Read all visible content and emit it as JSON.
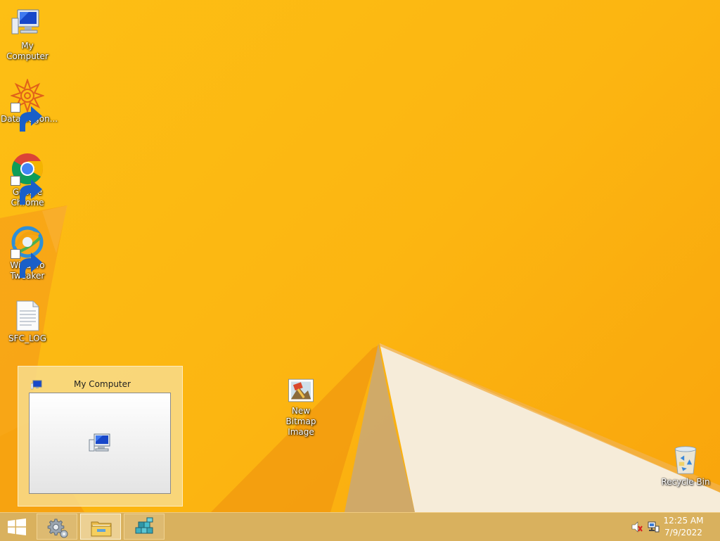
{
  "desktop": {
    "icons": [
      {
        "label": "My Computer",
        "icon": "computer-icon"
      },
      {
        "label": "DataWagon...",
        "icon": "datawagon-icon",
        "shortcut": true
      },
      {
        "label": "Google Chrome",
        "icon": "chrome-icon",
        "shortcut": true
      },
      {
        "label": "Winaero Tweaker",
        "icon": "winaero-tweaker-icon",
        "shortcut": true
      },
      {
        "label": "SFC_LOG",
        "icon": "text-file-icon"
      },
      {
        "label": "New Bitmap Image",
        "icon": "bitmap-image-icon"
      },
      {
        "label": "Recycle Bin",
        "icon": "recycle-bin-icon"
      }
    ]
  },
  "taskbar_thumbnail": {
    "title": "My Computer",
    "icon": "computer-icon"
  },
  "taskbar": {
    "start_icon": "windows-logo-icon",
    "buttons": [
      {
        "name": "settings",
        "icon": "gear-icon",
        "active": false
      },
      {
        "name": "file-explorer",
        "icon": "folder-icon",
        "active": true
      },
      {
        "name": "winaero-tweaker",
        "icon": "cubes-icon",
        "active": false
      }
    ],
    "tray": {
      "icons": [
        "speaker-muted-icon",
        "network-icon"
      ],
      "time": "12:25 AM",
      "date": "7/9/2022"
    }
  },
  "colors": {
    "wallpaper": "#fdbf14",
    "wallpaper_dark": "#f39a0a",
    "wallpaper_light": "#f6ecd9",
    "taskbar": "#d6aa50"
  }
}
